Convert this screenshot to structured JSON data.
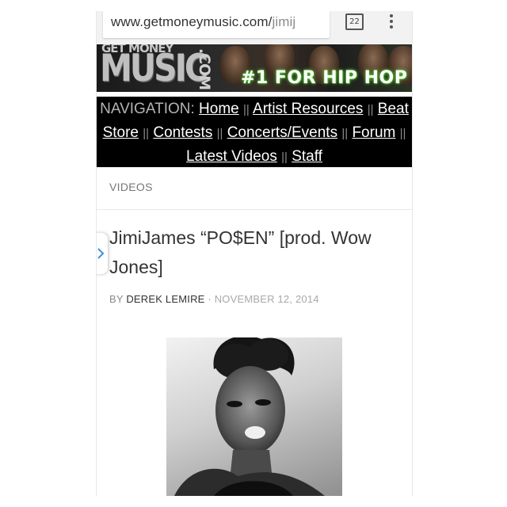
{
  "browser": {
    "url_domain": "www.getmoneymusic.com/",
    "url_path": "jimij",
    "tab_count": "22"
  },
  "banner": {
    "logo_top": "GET MONEY",
    "logo_main": "MUSIC",
    "logo_com": ".COM",
    "tagline": "#1 FOR HIP HOP"
  },
  "nav": {
    "label": "NAVIGATION:",
    "separator": "||",
    "items": [
      "Home",
      "Artist Resources",
      "Beat Store",
      "Contests",
      "Concerts/Events",
      "Forum",
      "Latest Videos",
      "Staff"
    ]
  },
  "article": {
    "category": "VIDEOS",
    "title": "JimiJames “PO$EN” [prod. Wow Jones]",
    "by_prefix": "BY",
    "author": "DEREK LEMIRE",
    "date_sep": " · ",
    "date": "NOVEMBER 12, 2014"
  }
}
